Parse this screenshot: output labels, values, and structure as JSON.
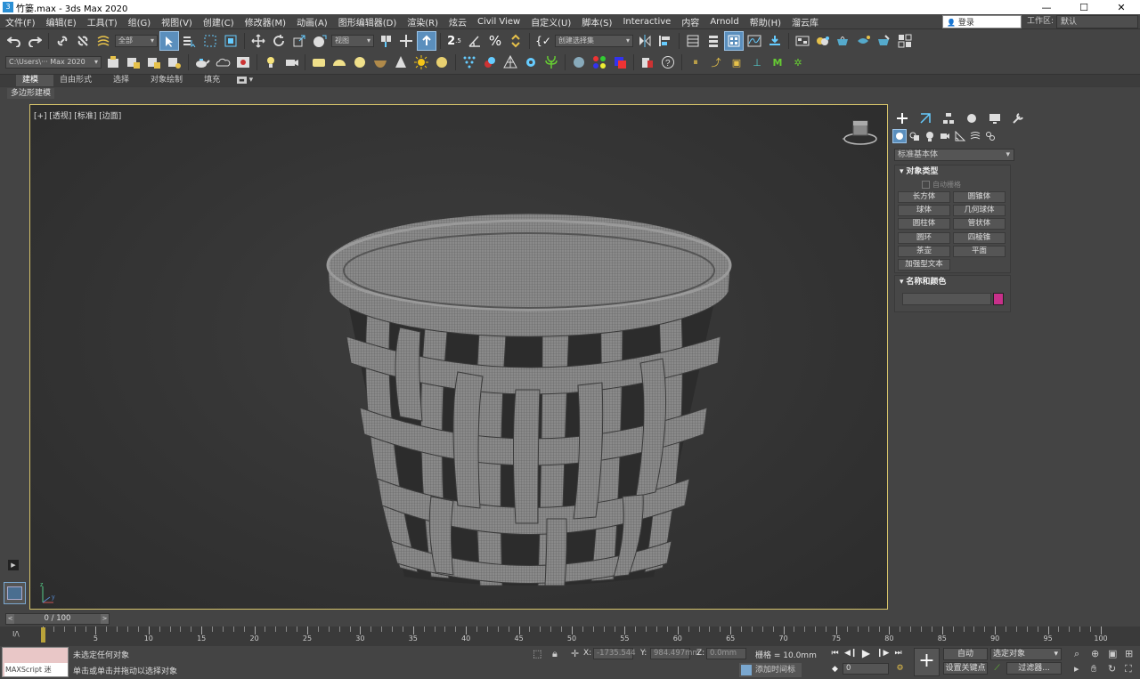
{
  "window": {
    "title": "竹篓.max - 3ds Max 2020",
    "app_icon": "3",
    "controls": [
      "—",
      "☐",
      "✕"
    ]
  },
  "menu": [
    "文件(F)",
    "编辑(E)",
    "工具(T)",
    "组(G)",
    "视图(V)",
    "创建(C)",
    "修改器(M)",
    "动画(A)",
    "图形编辑器(D)",
    "渲染(R)",
    "炫云",
    "Civil View",
    "自定义(U)",
    "脚本(S)",
    "Interactive",
    "内容",
    "Arnold",
    "帮助(H)",
    "溜云库"
  ],
  "signin": "登录",
  "workspace": {
    "label": "工作区:",
    "value": "默认"
  },
  "toolbar1": {
    "selection_filter": "全部",
    "ref_coord": "视图",
    "named_sets": "创建选择集"
  },
  "toolbar2": {
    "path": "C:\\Users\\··· Max 2020"
  },
  "ribbon": {
    "tabs": [
      "建模",
      "自由形式",
      "选择",
      "对象绘制",
      "填充"
    ],
    "active": "建模",
    "sub": "多边形建模"
  },
  "viewport": {
    "label": "[+] [透视] [标准] [边面]",
    "border_color": "#d6c36a"
  },
  "command_panel": {
    "dropdown": "标准基本体",
    "object_type": {
      "title": "对象类型",
      "autogrid": "自动栅格",
      "buttons": [
        "长方体",
        "圆锥体",
        "球体",
        "几何球体",
        "圆柱体",
        "管状体",
        "圆环",
        "四棱锥",
        "茶壶",
        "平面",
        "加强型文本"
      ]
    },
    "name_color": {
      "title": "名称和颜色",
      "color": "#c8308a"
    }
  },
  "time_slider": {
    "value": "0 / 100"
  },
  "timeline": {
    "labels": [
      "0",
      "5",
      "10",
      "15",
      "20",
      "25",
      "30",
      "35",
      "40",
      "45",
      "50",
      "55",
      "60",
      "65",
      "70",
      "75",
      "80",
      "85",
      "90",
      "95",
      "100"
    ]
  },
  "status": {
    "maxscript": "MAXScript 迷",
    "line1": "未选定任何对象",
    "line2": "单击或单击并拖动以选择对象",
    "x_label": "X:",
    "x_value": "-1735.544",
    "y_label": "Y:",
    "y_value": "984.497mm",
    "z_label": "Z:",
    "z_value": "0.0mm",
    "grid": "栅格 = 10.0mm",
    "add_time_tag": "添加时间标记",
    "frame": "0",
    "auto_key": "自动",
    "set_key": "设置关键点",
    "selected_object": "选定对象",
    "filters": "过滤器..."
  }
}
